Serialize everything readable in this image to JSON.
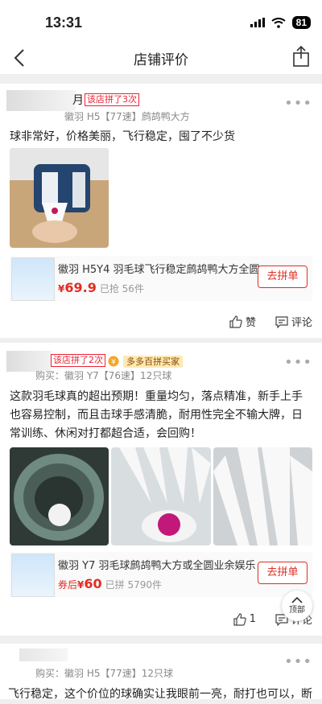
{
  "status": {
    "time": "13:31",
    "battery": "81"
  },
  "nav": {
    "title": "店铺评价"
  },
  "reviews": [
    {
      "user_fragment": "月",
      "badge": "该店拼了3次",
      "sku": "徽羽 H5【77速】鹧鸪鸭大方",
      "text": "球非常好，价格美丽，飞行稳定，囤了不少货",
      "product": {
        "name": "徽羽 H5Y4 羽毛球飞行稳定鹧鸪鸭大方全圆",
        "currency": "¥",
        "price": "69.9",
        "sold": "已抢 56件",
        "button": "去拼单"
      },
      "like_label": "赞",
      "comment_label": "评论"
    },
    {
      "badge": "该店拼了2次",
      "vip_label": "多多百拼买家",
      "sku": "购买：徽羽 Y7【76速】12只球",
      "text": "这款羽毛球真的超出预期！重量均匀，落点精准，新手上手也容易控制，而且击球手感清脆，耐用性完全不输大牌，日常训练、休闲对打都超合适，会回购！",
      "product": {
        "name": "徽羽 Y7 羽毛球鹧鸪鸭大方或全圆业余娱乐",
        "price_prefix": "券后",
        "currency": "¥",
        "price": "60",
        "sold": "已拼 5790件",
        "button": "去拼单"
      },
      "like_count": "1",
      "comment_label": "评论"
    },
    {
      "sku": "购买：徽羽 H5【77速】12只球",
      "text": "飞行稳定，这个价位的球确实让我眼前一亮，耐打也可以，断"
    }
  ],
  "top_button": {
    "label": "顶部"
  },
  "colors": {
    "accent": "#e02e24",
    "background": "#efefef"
  }
}
